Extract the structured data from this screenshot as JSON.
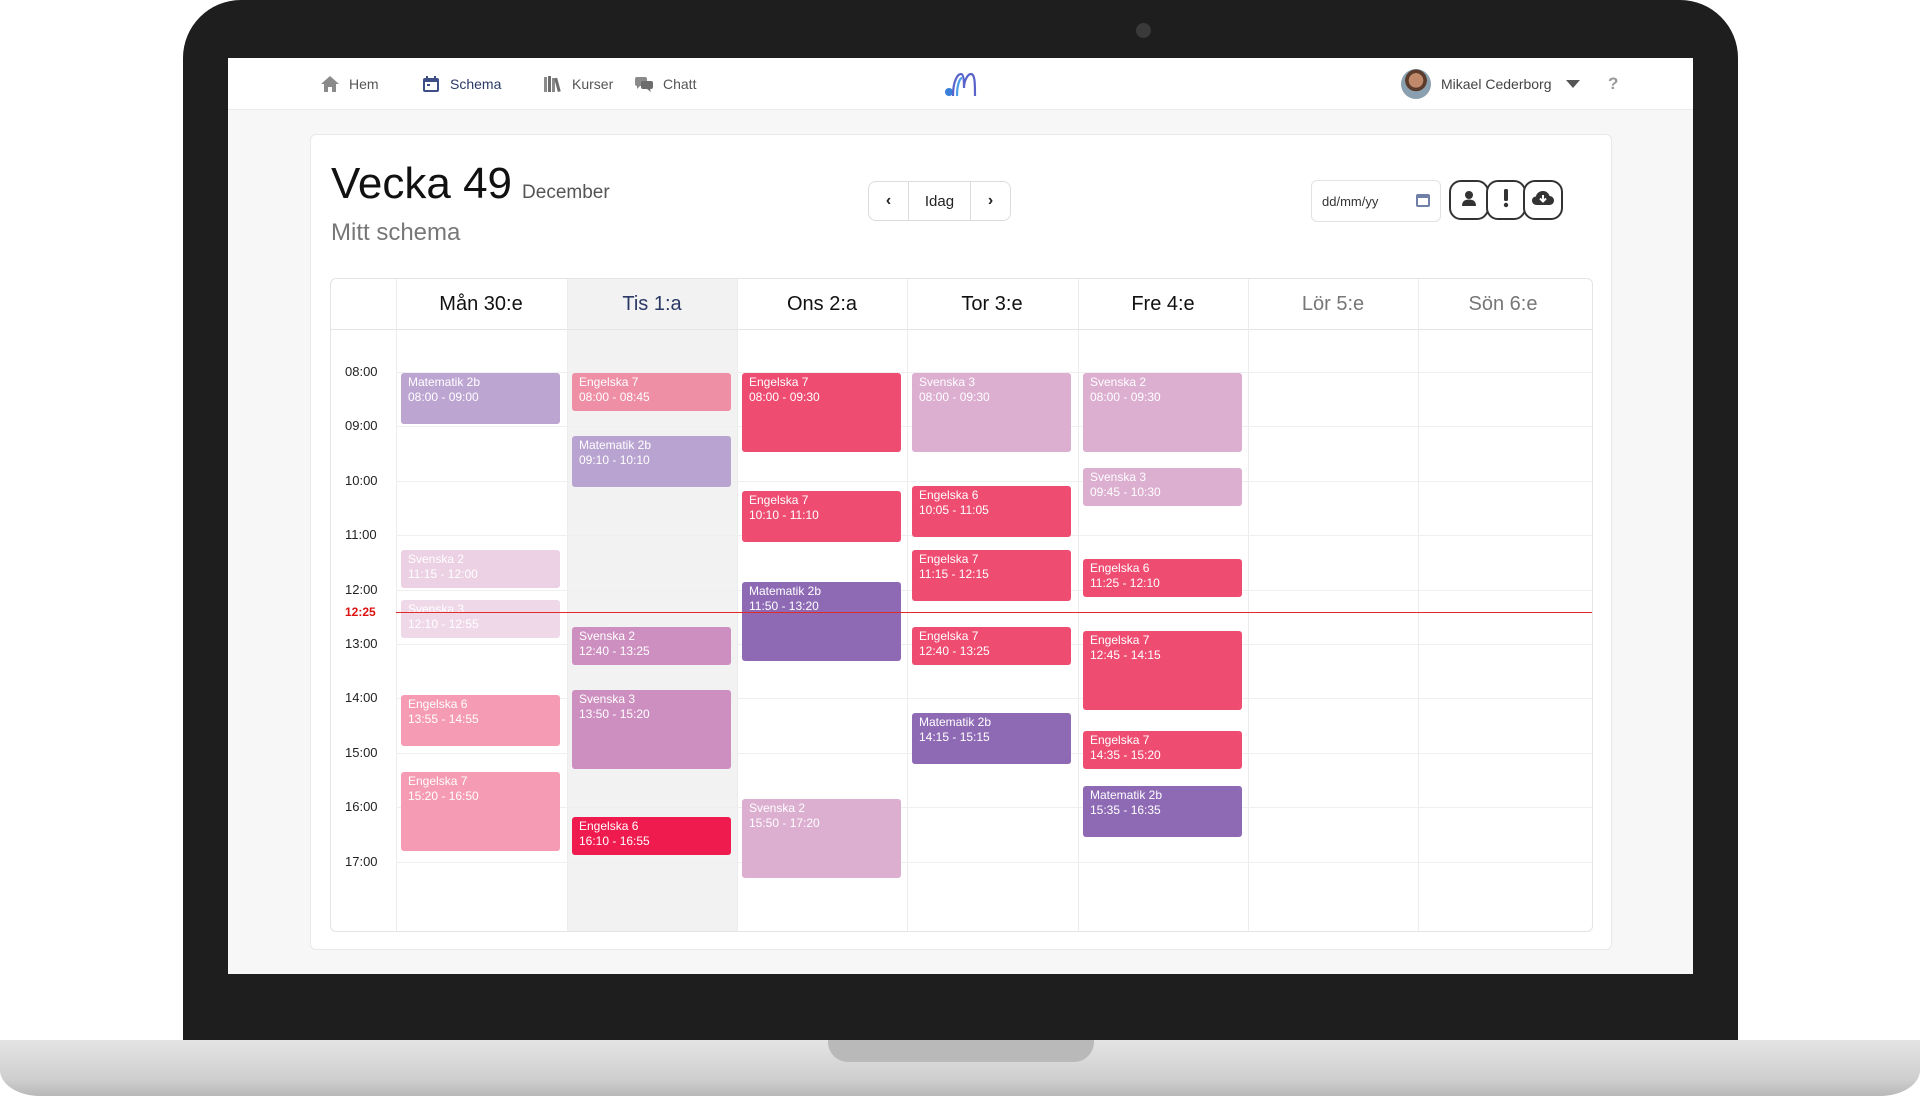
{
  "nav": {
    "items": [
      {
        "label": "Hem",
        "icon": "home-icon"
      },
      {
        "label": "Schema",
        "icon": "calendar-icon"
      },
      {
        "label": "Kurser",
        "icon": "books-icon"
      },
      {
        "label": "Chatt",
        "icon": "chat-icon"
      }
    ],
    "user_name": "Mikael Cederborg",
    "help": "?"
  },
  "header": {
    "week": "Vecka 49",
    "month": "December",
    "subtitle": "Mitt schema",
    "today_button": "Idag",
    "prev": "‹",
    "next": "›",
    "date_placeholder": "dd/mm/yy"
  },
  "calendar": {
    "days": [
      "Mån 30:e",
      "Tis 1:a",
      "Ons 2:a",
      "Tor 3:e",
      "Fre 4:e",
      "Lör 5:e",
      "Sön 6:e"
    ],
    "hours": [
      "08:00",
      "09:00",
      "10:00",
      "11:00",
      "12:00",
      "13:00",
      "14:00",
      "15:00",
      "16:00",
      "17:00"
    ],
    "now": "12:25",
    "colors": {
      "matematik": "#bda5d2",
      "engelska_light": "#f19cb3",
      "engelska": "#ef4c72",
      "svenska": "#dcaed0",
      "purple": "#8e6ab5"
    },
    "events": [
      {
        "day": 0,
        "title": "Matematik 2b",
        "time": "08:00 - 09:00",
        "start": 8.0,
        "end": 9.0,
        "color": "#bda5d2"
      },
      {
        "day": 0,
        "title": "Svenska 2",
        "time": "11:15 - 12:00",
        "start": 11.25,
        "end": 12.0,
        "color": "#ecd0e3"
      },
      {
        "day": 0,
        "title": "Svenska 3",
        "time": "12:10 - 12:55",
        "start": 12.1667,
        "end": 12.9167,
        "color": "#efd8e8"
      },
      {
        "day": 0,
        "title": "Engelska 6",
        "time": "13:55 - 14:55",
        "start": 13.9167,
        "end": 14.9167,
        "color": "#f59bb3"
      },
      {
        "day": 0,
        "title": "Engelska 7",
        "time": "15:20 - 16:50",
        "start": 15.3333,
        "end": 16.8333,
        "color": "#f59bb3"
      },
      {
        "day": 1,
        "title": "Engelska 7",
        "time": "08:00 - 08:45",
        "start": 8.0,
        "end": 8.75,
        "color": "#ef8fa6"
      },
      {
        "day": 1,
        "title": "Matematik 2b",
        "time": "09:10 - 10:10",
        "start": 9.1667,
        "end": 10.1667,
        "color": "#b9a3d0"
      },
      {
        "day": 1,
        "title": "Svenska 2",
        "time": "12:40 - 13:25",
        "start": 12.6667,
        "end": 13.4167,
        "color": "#cd8fc0"
      },
      {
        "day": 1,
        "title": "Svenska 3",
        "time": "13:50 - 15:20",
        "start": 13.8333,
        "end": 15.3333,
        "color": "#cd8fc0"
      },
      {
        "day": 1,
        "title": "Engelska 6",
        "time": "16:10 - 16:55",
        "start": 16.1667,
        "end": 16.9167,
        "color": "#ef1a4d"
      },
      {
        "day": 2,
        "title": "Engelska 7",
        "time": "08:00 - 09:30",
        "start": 8.0,
        "end": 9.5,
        "color": "#ef4c72"
      },
      {
        "day": 2,
        "title": "Engelska 7",
        "time": "10:10 - 11:10",
        "start": 10.1667,
        "end": 11.1667,
        "color": "#ef4c72"
      },
      {
        "day": 2,
        "title": "Matematik 2b",
        "time": "11:50 - 13:20",
        "start": 11.8333,
        "end": 13.3333,
        "color": "#8e6ab5"
      },
      {
        "day": 2,
        "title": "Svenska 2",
        "time": "15:50 - 17:20",
        "start": 15.8333,
        "end": 17.3333,
        "color": "#dcaed0"
      },
      {
        "day": 3,
        "title": "Svenska 3",
        "time": "08:00 - 09:30",
        "start": 8.0,
        "end": 9.5,
        "color": "#dcaed0"
      },
      {
        "day": 3,
        "title": "Engelska 6",
        "time": "10:05 - 11:05",
        "start": 10.0833,
        "end": 11.0833,
        "color": "#ef4c72"
      },
      {
        "day": 3,
        "title": "Engelska 7",
        "time": "11:15 - 12:15",
        "start": 11.25,
        "end": 12.25,
        "color": "#ef4c72"
      },
      {
        "day": 3,
        "title": "Engelska 7",
        "time": "12:40 - 13:25",
        "start": 12.6667,
        "end": 13.4167,
        "color": "#ef4c72"
      },
      {
        "day": 3,
        "title": "Matematik 2b",
        "time": "14:15 - 15:15",
        "start": 14.25,
        "end": 15.25,
        "color": "#8e6ab5"
      },
      {
        "day": 4,
        "title": "Svenska 2",
        "time": "08:00 - 09:30",
        "start": 8.0,
        "end": 9.5,
        "color": "#dcaed0"
      },
      {
        "day": 4,
        "title": "Svenska 3",
        "time": "09:45 - 10:30",
        "start": 9.75,
        "end": 10.5,
        "color": "#dcaed0"
      },
      {
        "day": 4,
        "title": "Engelska 6",
        "time": "11:25 - 12:10",
        "start": 11.4167,
        "end": 12.1667,
        "color": "#ef4c72"
      },
      {
        "day": 4,
        "title": "Engelska 7",
        "time": "12:45 - 14:15",
        "start": 12.75,
        "end": 14.25,
        "color": "#ef4c72"
      },
      {
        "day": 4,
        "title": "Engelska 7",
        "time": "14:35 - 15:20",
        "start": 14.5833,
        "end": 15.3333,
        "color": "#ef4c72"
      },
      {
        "day": 4,
        "title": "Matematik 2b",
        "time": "15:35 - 16:35",
        "start": 15.5833,
        "end": 16.5833,
        "color": "#8e6ab5"
      }
    ]
  }
}
